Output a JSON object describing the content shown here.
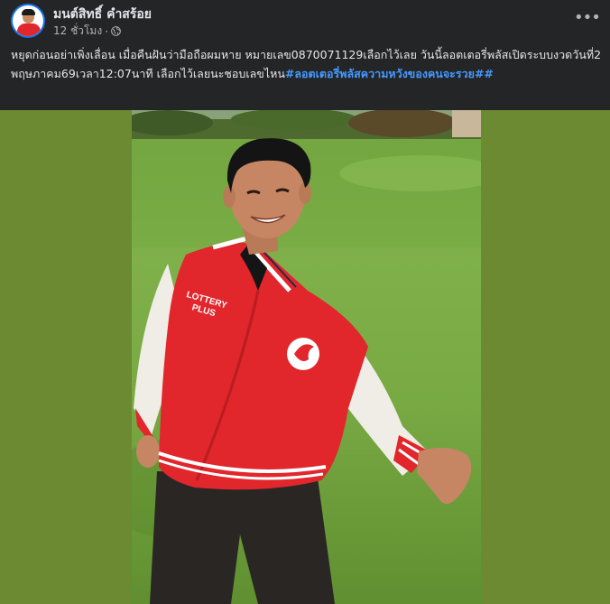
{
  "post": {
    "author_name": "มนต์สิทธิ์ คำสร้อย",
    "timestamp": "12 ชั่วโมง",
    "meta_separator": "·",
    "privacy_icon": "globe-icon",
    "more_icon": "more-horizontal-icon",
    "caption_text": "หยุดก่อนอย่าเพิ่งเลื่อน  เมื่อคืนฝันว่ามือถือผมหาย หมายเลข0870071129เลือกไว้เลย วันนี้ลอตเตอรี่พลัสเปิดระบบงวดวันที่2พฤษภาคม69เวลา12:07นาที เลือกไว้เลยนะชอบเลขไหน",
    "hashtag": "#ลอตเตอรี่พลัสความหวังของคนจะรวย##",
    "photo": {
      "jacket_text_line1": "LOTTERY",
      "jacket_text_line2": "PLUS"
    }
  },
  "colors": {
    "background": "#242526",
    "hashtag": "#4599ff",
    "media_background": "#6b8a31",
    "jacket_red": "#e1262c"
  }
}
